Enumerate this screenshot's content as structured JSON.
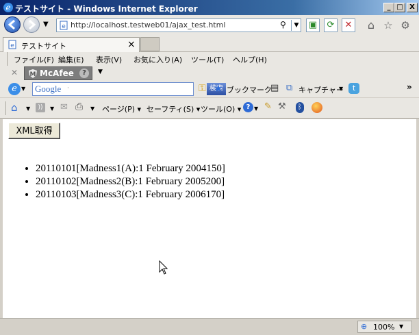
{
  "window": {
    "title": "テストサイト - Windows Internet Explorer",
    "minimize_glyph": "_",
    "maximize_glyph": "□",
    "close_glyph": "X"
  },
  "address_bar": {
    "url": "http://localhost.testweb01/ajax_test.html"
  },
  "tab": {
    "title": "テストサイト",
    "close_glyph": "×"
  },
  "menu": [
    "ファイル(F)",
    "編集(E)",
    "表示(V)",
    "お気に入り(A)",
    "ツール(T)",
    "ヘルプ(H)"
  ],
  "mcafee": {
    "logo_text": "McAfee",
    "help_glyph": "?"
  },
  "google_toolbar": {
    "logo": "Google",
    "search_button": "検索",
    "bookmark": "ブックマーク",
    "capture": "キャプチャー"
  },
  "command_bar": {
    "page": "ページ(P)",
    "safety": "セーフティ(S)",
    "tools": "ツール(O)"
  },
  "content": {
    "button_label": "XML取得",
    "items": [
      "20110101[Madness1(A):1 February 2004150]",
      "20110102[Madness2(B):1 February 2005200]",
      "20110103[Madness3(C):1 February 2006170]"
    ]
  },
  "status": {
    "zoom": "100%"
  }
}
